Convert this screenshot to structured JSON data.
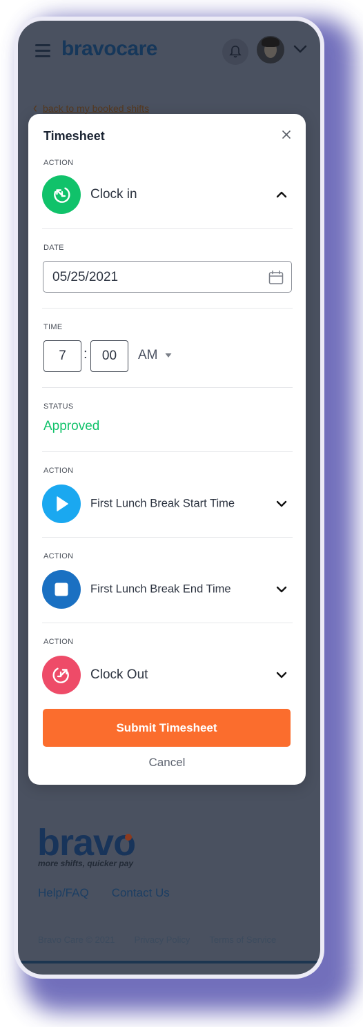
{
  "background": {
    "brand": "bravocare",
    "back_link": "back to my booked shifts",
    "footer_brand": "bravo",
    "tagline": "more shifts, quicker pay",
    "links": [
      "Help/FAQ",
      "Contact Us"
    ],
    "legal": [
      "Bravo Care © 2021",
      "Privacy Policy",
      "Terms of Service"
    ]
  },
  "modal": {
    "title": "Timesheet",
    "action_label": "ACTION",
    "clock_in": {
      "label": "Clock in",
      "color": "#10c26a",
      "icon": "clock-in-icon"
    },
    "date": {
      "label": "DATE",
      "value": "05/25/2021"
    },
    "time": {
      "label": "TIME",
      "hour": "7",
      "minute": "00",
      "period": "AM"
    },
    "status": {
      "label": "STATUS",
      "value": "Approved"
    },
    "lunch_start": {
      "label": "First Lunch Break Start Time",
      "color": "#1aa8f0",
      "icon": "play-icon"
    },
    "lunch_end": {
      "label": "First Lunch Break End Time",
      "color": "#1a70c2",
      "icon": "stop-icon"
    },
    "clock_out": {
      "label": "Clock Out",
      "color": "#ee4b68",
      "icon": "clock-out-icon"
    },
    "submit_label": "Submit Timesheet",
    "cancel_label": "Cancel"
  },
  "colors": {
    "accent": "#fb6d2d",
    "approved": "#10c26a"
  }
}
